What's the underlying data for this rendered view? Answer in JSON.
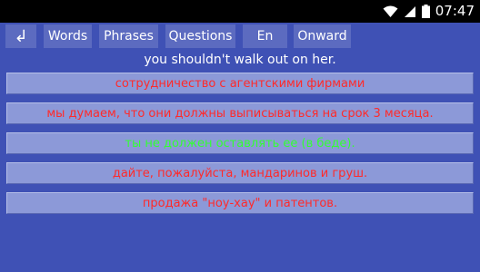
{
  "status_bar": {
    "time": "07:47",
    "icons": [
      "wifi-icon",
      "cell-signal-icon",
      "battery-icon"
    ]
  },
  "toolbar": {
    "back_icon": "return-arrow-icon",
    "back_glyph": "↲",
    "words_label": "Words",
    "phrases_label": "Phrases",
    "questions_label": "Questions",
    "lang_label": "En",
    "onward_label": "Onward"
  },
  "prompt": "you shouldn't walk out on her.",
  "answers": [
    {
      "text": "сотрудничество с агентскими фирмами",
      "color": "#ff2a2a"
    },
    {
      "text": "мы думаем, что они должны выписываться на срок 3 месяца.",
      "color": "#ff2a2a"
    },
    {
      "text": "ты не должен оставлять ее (в беде).",
      "color": "#33ff33"
    },
    {
      "text": "дайте, пожалуйста, мандаринов и груш.",
      "color": "#ff2a2a"
    },
    {
      "text": "продажа \"ноу-хау\" и патентов.",
      "color": "#ff2a2a"
    }
  ],
  "colors": {
    "background": "#3f51b5",
    "button": "#5c6bc0",
    "answer_bg": "#8c99d8",
    "wrong": "#ff2a2a",
    "correct": "#33ff33"
  }
}
